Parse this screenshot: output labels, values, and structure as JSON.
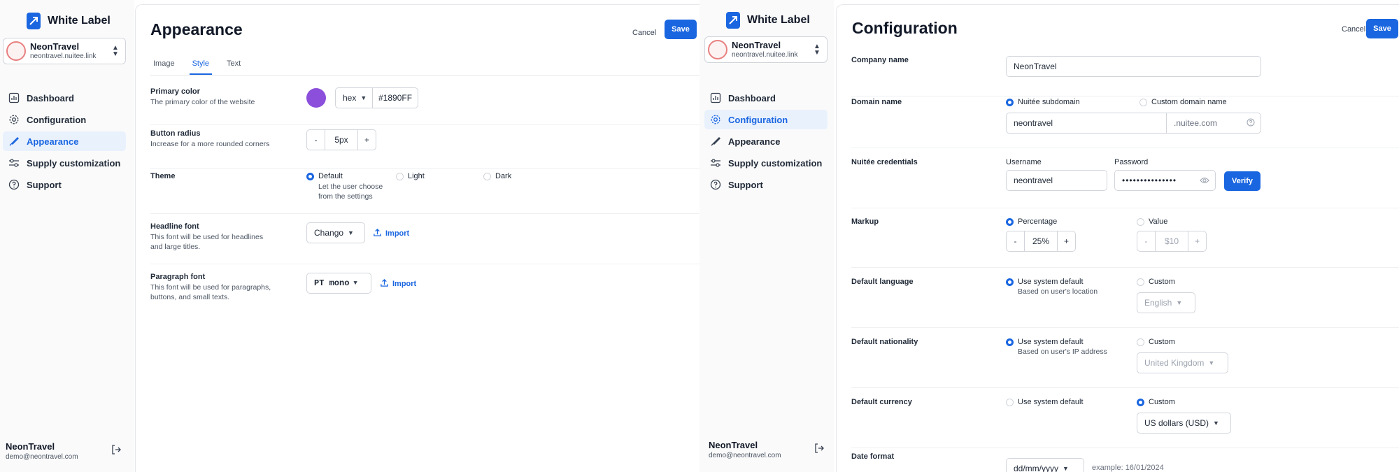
{
  "left": {
    "brand": "White Label",
    "account": {
      "name": "NeonTravel",
      "domain": "neontravel.nuitee.link"
    },
    "nav": [
      {
        "label": "Dashboard",
        "icon": "chart-icon"
      },
      {
        "label": "Configuration",
        "icon": "gear-icon"
      },
      {
        "label": "Appearance",
        "icon": "brush-icon",
        "active": true
      },
      {
        "label": "Supply customization",
        "icon": "sliders-icon"
      },
      {
        "label": "Support",
        "icon": "help-icon"
      }
    ],
    "user": {
      "name": "NeonTravel",
      "email": "demo@neontravel.com"
    },
    "page_title": "Appearance",
    "cancel_label": "Cancel",
    "save_label": "Save",
    "tabs": [
      "Image",
      "Style",
      "Text"
    ],
    "active_tab": "Style",
    "primary_color": {
      "label": "Primary color",
      "desc": "The primary color of the website",
      "swatch": "#8b4fdb",
      "format": "hex",
      "value": "#1890FF"
    },
    "button_radius": {
      "label": "Button radius",
      "desc": "Increase for a more rounded corners",
      "minus": "-",
      "plus": "+",
      "value": "5px"
    },
    "theme": {
      "label": "Theme",
      "options": [
        {
          "label": "Default",
          "sub1": "Let the user choose",
          "sub2": "from the settings",
          "selected": true
        },
        {
          "label": "Light"
        },
        {
          "label": "Dark"
        }
      ]
    },
    "headline_font": {
      "label": "Headline font",
      "desc1": "This font will be used for headlines",
      "desc2": "and large titles.",
      "value": "Chango",
      "import": "Import"
    },
    "paragraph_font": {
      "label": "Paragraph font",
      "desc1": "This font will be used for paragraphs,",
      "desc2": "buttons, and small texts.",
      "value": "PT mono",
      "import": "Import"
    }
  },
  "right": {
    "brand": "White Label",
    "account": {
      "name": "NeonTravel",
      "domain": "neontravel.nuitee.link"
    },
    "nav": [
      {
        "label": "Dashboard",
        "icon": "chart-icon"
      },
      {
        "label": "Configuration",
        "icon": "gear-icon",
        "active": true
      },
      {
        "label": "Appearance",
        "icon": "brush-icon"
      },
      {
        "label": "Supply customization",
        "icon": "sliders-icon"
      },
      {
        "label": "Support",
        "icon": "help-icon"
      }
    ],
    "user": {
      "name": "NeonTravel",
      "email": "demo@neontravel.com"
    },
    "page_title": "Configuration",
    "cancel_label": "Cancel",
    "save_label": "Save",
    "company_name": {
      "label": "Company name",
      "value": "NeonTravel"
    },
    "domain_name": {
      "label": "Domain name",
      "option_subdomain": "Nuitée subdomain",
      "option_custom": "Custom domain name",
      "value": "neontravel",
      "suffix": ".nuitee.com"
    },
    "credentials": {
      "label": "Nuitée credentials",
      "username_label": "Username",
      "username_value": "neontravel",
      "password_label": "Password",
      "password_value": "•••••••••••••••",
      "verify": "Verify"
    },
    "markup": {
      "label": "Markup",
      "option_percentage": "Percentage",
      "option_value": "Value",
      "percentage_value": "25%",
      "amount_value": "$10",
      "minus": "-",
      "plus": "+"
    },
    "default_language": {
      "label": "Default language",
      "option_system": "Use system default",
      "option_system_sub": "Based on user's location",
      "option_custom": "Custom",
      "custom_value": "English"
    },
    "default_nationality": {
      "label": "Default nationality",
      "option_system": "Use system default",
      "option_system_sub": "Based on user's IP address",
      "option_custom": "Custom",
      "custom_value": "United Kingdom"
    },
    "default_currency": {
      "label": "Default currency",
      "option_system": "Use system default",
      "option_custom": "Custom",
      "custom_value": "US dollars (USD)"
    },
    "date_format": {
      "label": "Date format",
      "value": "dd/mm/yyyy",
      "example": "example: 16/01/2024"
    }
  },
  "colors": {
    "accent": "#1a66e0",
    "active_bg": "#e9f1fd",
    "swatch": "#8b4fdb"
  }
}
